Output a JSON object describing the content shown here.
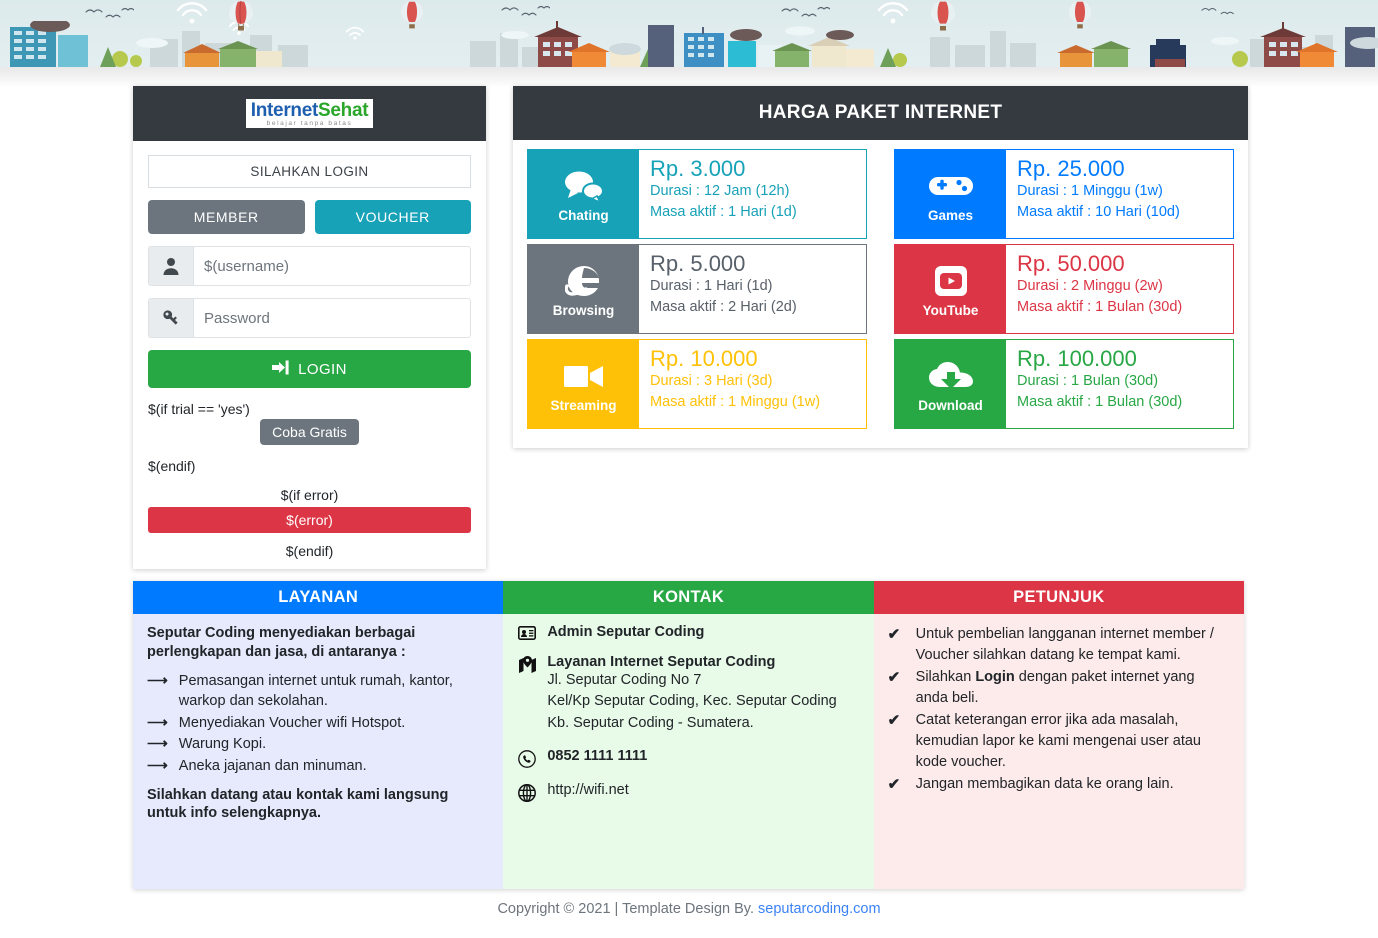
{
  "brand": {
    "logo_primary": "Internet",
    "logo_secondary": "Sehat",
    "logo_tagline": "belajar tanpa batas"
  },
  "login": {
    "title": "SILAHKAN LOGIN",
    "tabs": [
      {
        "label": "MEMBER",
        "color": "#6c757d",
        "active": false
      },
      {
        "label": "VOUCHER",
        "color": "#17a2b8",
        "active": true
      }
    ],
    "username": {
      "icon": "user-icon",
      "value": "$(username)",
      "placeholder": "$(username)"
    },
    "password": {
      "icon": "key-icon",
      "value": "",
      "placeholder": "Password"
    },
    "login_button": "LOGIN",
    "login_icon": "sign-in-icon",
    "trial_if": "$(if trial == 'yes')",
    "trial_button": "Coba Gratis",
    "trial_endif": "$(endif)",
    "error_if": "$(if error)",
    "error_text": "$(error)",
    "error_endif": "$(endif)"
  },
  "prices": {
    "title": "HARGA PAKET INTERNET",
    "left": [
      {
        "name": "Chating",
        "icon": "chat-icon",
        "color": "#17a2b8",
        "price": "Rp. 3.000",
        "duration": "Durasi : 12 Jam (12h)",
        "active_period": "Masa aktif : 1 Hari (1d)"
      },
      {
        "name": "Browsing",
        "icon": "internet-explorer-icon",
        "color": "#6c757d",
        "price": "Rp. 5.000",
        "duration": "Durasi : 1 Hari (1d)",
        "active_period": "Masa aktif : 2 Hari (2d)"
      },
      {
        "name": "Streaming",
        "icon": "video-camera-icon",
        "color": "#ffc107",
        "price": "Rp. 10.000",
        "duration": "Durasi : 3 Hari (3d)",
        "active_period": "Masa aktif : 1 Minggu (1w)"
      }
    ],
    "right": [
      {
        "name": "Games",
        "icon": "gamepad-icon",
        "color": "#007bff",
        "price": "Rp. 25.000",
        "duration": "Durasi : 1 Minggu (1w)",
        "active_period": "Masa aktif : 10 Hari (10d)"
      },
      {
        "name": "YouTube",
        "icon": "youtube-icon",
        "color": "#dc3545",
        "price": "Rp. 50.000",
        "duration": "Durasi : 2 Minggu (2w)",
        "active_period": "Masa aktif : 1 Bulan (30d)"
      },
      {
        "name": "Download",
        "icon": "cloud-download-icon",
        "color": "#28a745",
        "price": "Rp. 100.000",
        "duration": "Durasi : 1 Bulan (30d)",
        "active_period": "Masa aktif : 1 Bulan (30d)"
      }
    ]
  },
  "layanan": {
    "title": "LAYANAN",
    "header_color": "#007bff",
    "body_color": "#e6eafc",
    "intro": "Seputar Coding menyediakan berbagai perlengkapan dan jasa, di antaranya :",
    "items": [
      "Pemasangan internet untuk rumah, kantor, warkop dan sekolahan.",
      "Menyediakan Voucher wifi Hotspot.",
      "Warung Kopi.",
      "Aneka jajanan dan minuman."
    ],
    "outro": "Silahkan datang atau kontak kami langsung untuk info selengkapnya."
  },
  "kontak": {
    "title": "KONTAK",
    "header_color": "#28a745",
    "body_color": "#e8fae8",
    "admin_icon": "id-card-icon",
    "admin": "Admin Seputar Coding",
    "address_icon": "map-marker-icon",
    "address_title": "Layanan Internet Seputar Coding",
    "address_lines": [
      "Jl. Seputar Coding No 7",
      "Kel/Kp Seputar Coding, Kec. Seputar Coding",
      "Kb. Seputar Coding - Sumatera."
    ],
    "phone_icon": "whatsapp-icon",
    "phone": "0852 1111 1111",
    "web_icon": "globe-icon",
    "website": "http://wifi.net"
  },
  "petunjuk": {
    "title": "PETUNJUK",
    "header_color": "#dc3545",
    "body_color": "#fdeaea",
    "items": [
      "Untuk pembelian langganan internet member / Voucher silahkan datang ke tempat kami.",
      "Silahkan Login dengan paket internet yang anda beli.",
      "Catat keterangan error jika ada masalah, kemudian lapor ke kami mengenai user atau kode voucher.",
      "Jangan membagikan data ke orang lain."
    ]
  },
  "footer": {
    "text": "Copyright © 2021 | Template Design By.",
    "link": "seputarcoding.com"
  }
}
